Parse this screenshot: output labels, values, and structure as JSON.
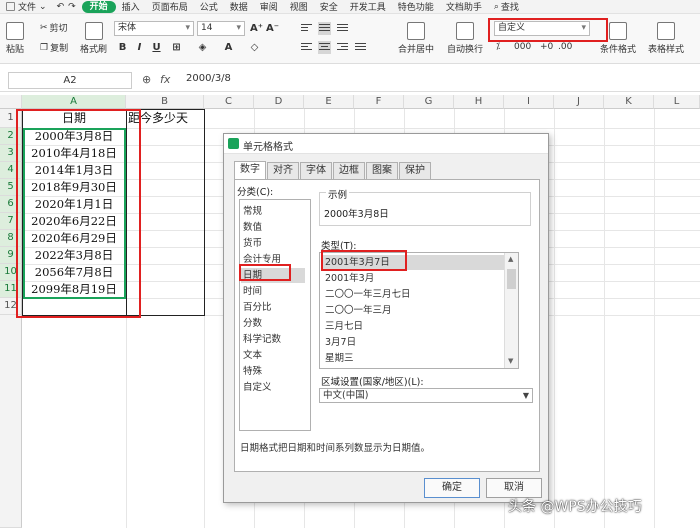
{
  "menu": {
    "file": "文件",
    "tabs": [
      "开始",
      "插入",
      "页面布局",
      "公式",
      "数据",
      "审阅",
      "视图",
      "安全",
      "开发工具",
      "特色功能",
      "文档助手"
    ],
    "search": "查找"
  },
  "ribbon": {
    "cut": "剪切",
    "copy": "复制",
    "format_painter": "格式刷",
    "paste": "粘贴",
    "font_name": "宋体",
    "font_size": "14",
    "bold": "B",
    "italic": "I",
    "underline": "U",
    "merge_center": "合并居中",
    "wrap_text": "自动换行",
    "number_format": "自定义",
    "conditional_format": "条件格式",
    "table_style": "表格样式"
  },
  "formula_bar": {
    "name_box": "A2",
    "fx": "fx",
    "value": "2000/3/8"
  },
  "sheet": {
    "columns": [
      "A",
      "B",
      "C",
      "D",
      "E",
      "F",
      "G",
      "H",
      "I",
      "J",
      "K",
      "L"
    ],
    "rows": [
      "1",
      "2",
      "3",
      "4",
      "5",
      "6",
      "7",
      "8",
      "9",
      "10",
      "11",
      "12"
    ],
    "header_a": "日期",
    "header_b": "距今多少天",
    "dates": [
      "2000年3月8日",
      "2010年4月18日",
      "2014年1月3日",
      "2018年9月30日",
      "2020年1月1日",
      "2020年6月22日",
      "2020年6月29日",
      "2022年3月8日",
      "2056年7月8日",
      "2099年8月19日"
    ]
  },
  "dialog": {
    "title": "单元格格式",
    "tabs": [
      "数字",
      "对齐",
      "字体",
      "边框",
      "图案",
      "保护"
    ],
    "category_label": "分类(C):",
    "categories": [
      "常规",
      "数值",
      "货币",
      "会计专用",
      "日期",
      "时间",
      "百分比",
      "分数",
      "科学记数",
      "文本",
      "特殊",
      "自定义"
    ],
    "sample_label": "示例",
    "sample_value": "2000年3月8日",
    "type_label": "类型(T):",
    "types": [
      "2001年3月7日",
      "2001年3月",
      "二〇〇一年三月七日",
      "二〇〇一年三月",
      "三月七日",
      "3月7日",
      "星期三"
    ],
    "locale_label": "区域设置(国家/地区)(L):",
    "locale_value": "中文(中国)",
    "description": "日期格式把日期和时间系列数显示为日期值。",
    "ok": "确定",
    "cancel": "取消"
  },
  "watermark": "头条 @WPS办公技巧",
  "colors": {
    "accent_green": "#1aa35a",
    "highlight_red": "#e02020"
  }
}
